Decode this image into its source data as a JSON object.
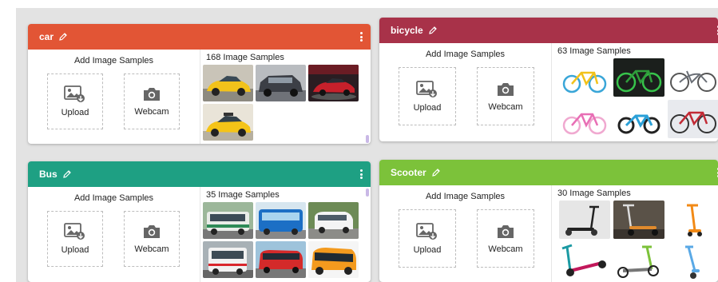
{
  "colors": {
    "car": "#e25535",
    "bicycle": "#a83249",
    "bus": "#1ea083",
    "scooter": "#7cc23a"
  },
  "common": {
    "add_title": "Add Image Samples",
    "upload_label": "Upload",
    "webcam_label": "Webcam"
  },
  "classes": [
    {
      "title": "car",
      "samples_label": "168 Image Samples",
      "thumbs": [
        "yellow-car",
        "dark-suv",
        "red-car-showroom",
        "yellow-taxi"
      ]
    },
    {
      "title": "bicycle",
      "samples_label": "63 Image Samples",
      "thumbs": [
        "kids-bike-blue",
        "green-bike-dark",
        "cruiser-bike",
        "pink-kids-bike",
        "blue-kids-bike",
        "red-road-bike"
      ]
    },
    {
      "title": "Bus",
      "samples_label": "35 Image Samples",
      "thumbs": [
        "green-bus",
        "blue-bus",
        "white-van",
        "white-bus",
        "red-bus",
        "orange-coach"
      ]
    },
    {
      "title": "Scooter",
      "samples_label": "30 Image Samples",
      "thumbs": [
        "black-scooter",
        "scooter-wall",
        "orange-scooter",
        "teal-scooter",
        "green-kick-scooter",
        "blue-scooter"
      ]
    }
  ]
}
